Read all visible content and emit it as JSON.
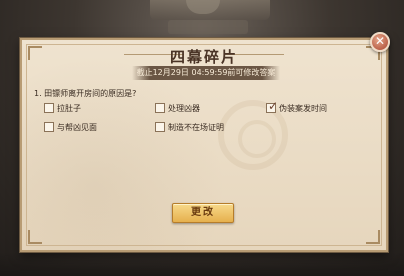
{
  "dialog": {
    "title": "四幕碎片",
    "deadline": "截止12月29日 04:59:59前可修改答案",
    "question": "1. 田镖师离开房间的原因是?",
    "options": [
      {
        "label": "拉肚子",
        "checked": false
      },
      {
        "label": "处理凶器",
        "checked": false
      },
      {
        "label": "伪装案发时间",
        "checked": true
      },
      {
        "label": "与帮凶见面",
        "checked": false
      },
      {
        "label": "制造不在场证明",
        "checked": false
      }
    ],
    "submit_label": "更改",
    "close_glyph": "✕",
    "check_glyph": "✓"
  }
}
